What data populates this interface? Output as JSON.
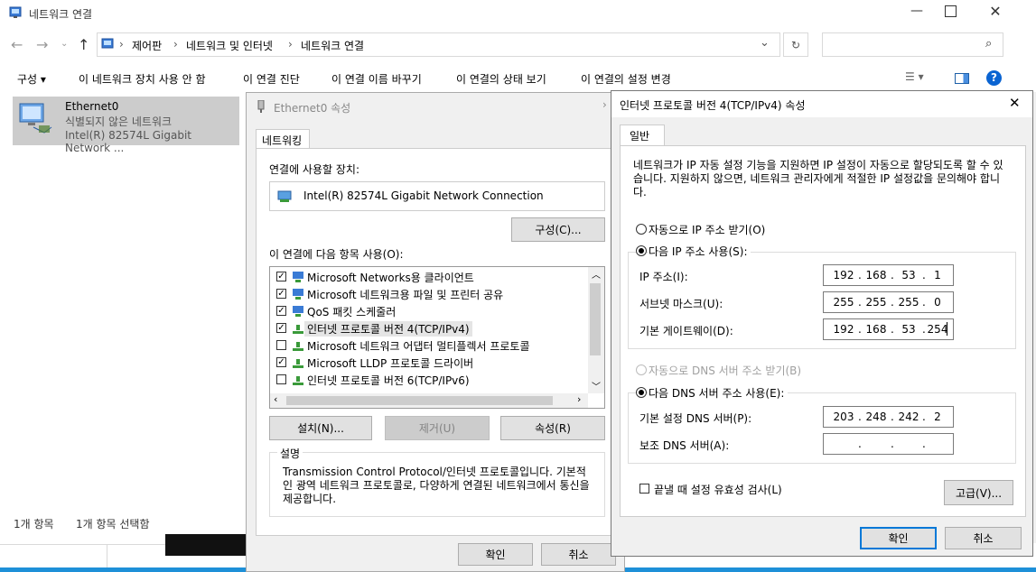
{
  "explorer": {
    "title": "네트워크 연결",
    "breadcrumb": [
      "제어판",
      "네트워크 및 인터넷",
      "네트워크 연결"
    ],
    "toolbar": [
      "구성 ▾",
      "이 네트워크 장치 사용 안 함",
      "이 연결 진단",
      "이 연결 이름 바꾸기",
      "이 연결의 상태 보기",
      "이 연결의 설정 변경"
    ],
    "adapter": {
      "name": "Ethernet0",
      "status": "식별되지 않은 네트워크",
      "device": "Intel(R) 82574L Gigabit Network ..."
    },
    "status_items": "1개 항목",
    "status_selected": "1개 항목 선택함"
  },
  "props": {
    "title": "Ethernet0 속성",
    "tab": "네트워킹",
    "connect_using_label": "연결에 사용할 장치:",
    "device": "Intel(R) 82574L Gigabit Network Connection",
    "configure_btn": "구성(C)...",
    "items_label": "이 연결에 다음 항목 사용(O):",
    "items": [
      {
        "label": "Microsoft Networks용 클라이언트",
        "checked": true
      },
      {
        "label": "Microsoft 네트워크용 파일 및 프린터 공유",
        "checked": true
      },
      {
        "label": "QoS 패킷 스케줄러",
        "checked": true
      },
      {
        "label": "인터넷 프로토콜 버전 4(TCP/IPv4)",
        "checked": true
      },
      {
        "label": "Microsoft 네트워크 어댑터 멀티플렉서 프로토콜",
        "checked": false
      },
      {
        "label": "Microsoft LLDP 프로토콜 드라이버",
        "checked": true
      },
      {
        "label": "인터넷 프로토콜 버전 6(TCP/IPv6)",
        "checked": false
      }
    ],
    "install_btn": "설치(N)...",
    "remove_btn": "제거(U)",
    "properties_btn": "속성(R)",
    "desc_label": "설명",
    "description": "Transmission Control Protocol/인터넷 프로토콜입니다. 기본적인 광역 네트워크 프로토콜로, 다양하게 연결된 네트워크에서 통신을 제공합니다.",
    "ok_btn": "확인",
    "cancel_btn": "취소"
  },
  "ipv4": {
    "title": "인터넷 프로토콜 버전 4(TCP/IPv4) 속성",
    "tab": "일반",
    "intro": "네트워크가 IP 자동 설정 기능을 지원하면 IP 설정이 자동으로 할당되도록 할 수 있습니다. 지원하지 않으면, 네트워크 관리자에게 적절한 IP 설정값을 문의해야 합니다.",
    "auto_ip": "자동으로 IP 주소 받기(O)",
    "manual_ip": "다음 IP 주소 사용(S):",
    "ip_label": "IP 주소(I):",
    "ip": [
      "192",
      "168",
      "53",
      "1"
    ],
    "mask_label": "서브넷 마스크(U):",
    "mask": [
      "255",
      "255",
      "255",
      "0"
    ],
    "gw_label": "기본 게이트웨이(D):",
    "gw": [
      "192",
      "168",
      "53",
      "254"
    ],
    "auto_dns": "자동으로 DNS 서버 주소 받기(B)",
    "manual_dns": "다음 DNS 서버 주소 사용(E):",
    "dns1_label": "기본 설정 DNS 서버(P):",
    "dns1": [
      "203",
      "248",
      "242",
      "2"
    ],
    "dns2_label": "보조 DNS 서버(A):",
    "dns2": [
      "",
      "",
      "",
      ""
    ],
    "validate": "끝낼 때 설정 유효성 검사(L)",
    "advanced_btn": "고급(V)...",
    "ok_btn": "확인",
    "cancel_btn": "취소"
  }
}
